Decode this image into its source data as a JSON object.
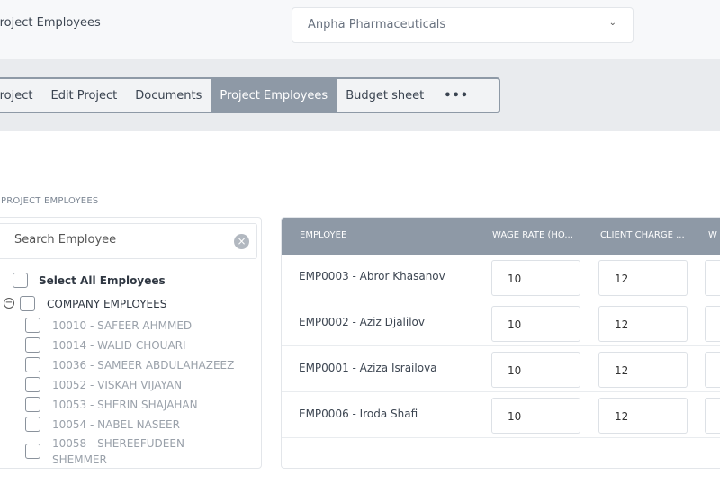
{
  "header": {
    "title": "Project Employees",
    "company_select": {
      "value": "Anpha Pharmaceuticals",
      "icon": "chevron-down-icon"
    }
  },
  "tabs": [
    {
      "label": "Project",
      "active": false
    },
    {
      "label": "Edit Project",
      "active": false
    },
    {
      "label": "Documents",
      "active": false
    },
    {
      "label": "Project Employees",
      "active": true
    },
    {
      "label": "Budget sheet",
      "active": false
    },
    {
      "label": "•••",
      "active": false
    }
  ],
  "section_label": "PROJECT EMPLOYEES",
  "left_panel": {
    "search_placeholder": "Search Employee",
    "select_all_label": "Select All Employees",
    "group_label": "COMPANY EMPLOYEES",
    "employees": [
      "10010 - SAFEER AHMMED",
      "10014 - WALID CHOUARI",
      "10036 - SAMEER ABDULAHAZEEZ",
      "10052 - VISKAH VIJAYAN",
      "10053 - SHERIN SHAJAHAN",
      "10054 - NABEL NASEER",
      "10058 - SHEREEFUDEEN",
      "SHEMMER"
    ]
  },
  "table": {
    "headers": [
      "EMPLOYEE",
      "WAGE RATE (HO...",
      "CLIENT CHARGE ...",
      "W"
    ],
    "rows": [
      {
        "employee": "EMP0003 - Abror Khasanov",
        "wage": "10",
        "charge": "12"
      },
      {
        "employee": "EMP0002 - Aziz Djalilov",
        "wage": "10",
        "charge": "12"
      },
      {
        "employee": "EMP0001 - Aziza Israilova",
        "wage": "10",
        "charge": "12"
      },
      {
        "employee": "EMP0006 - Iroda Shafi",
        "wage": "10",
        "charge": "12"
      }
    ]
  }
}
